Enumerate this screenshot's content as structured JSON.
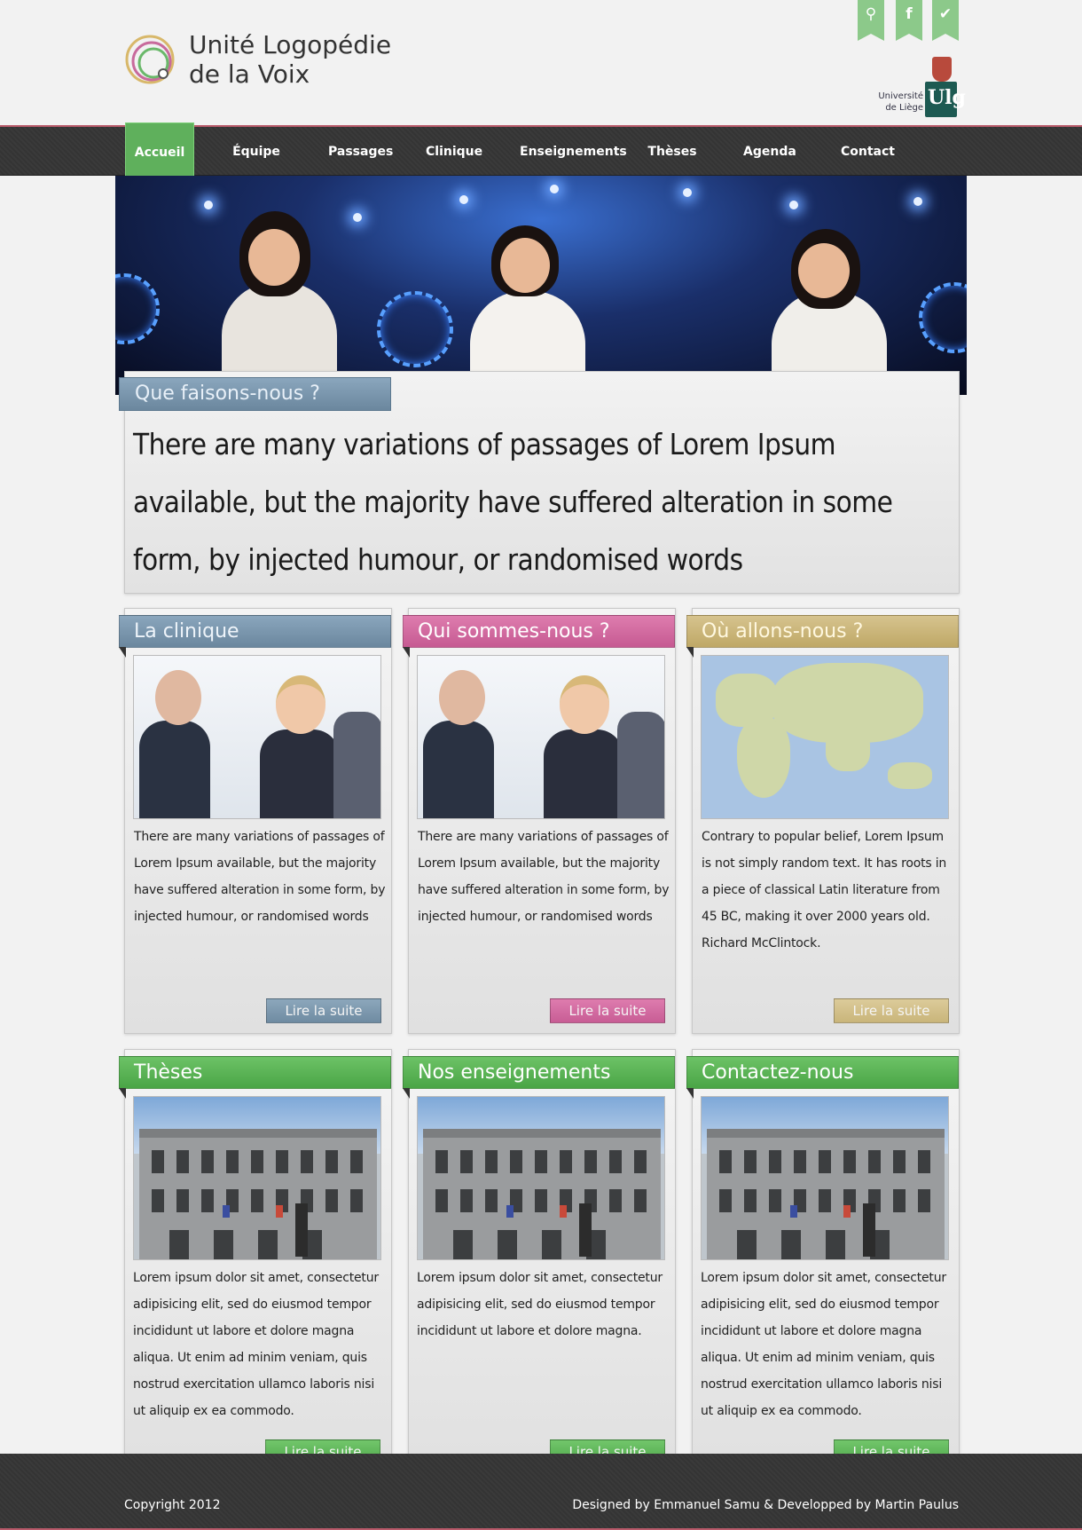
{
  "header": {
    "logo_line1": "Unité Logopédie",
    "logo_line2": "de la Voix",
    "university_line1": "Université",
    "university_line2": "de Liège",
    "university_mark": "Ulg",
    "social": [
      {
        "icon": "search-icon",
        "glyph": "⚲"
      },
      {
        "icon": "facebook-icon",
        "glyph": "f"
      },
      {
        "icon": "twitter-icon",
        "glyph": "✔"
      }
    ],
    "social_color": "#8cc98a"
  },
  "nav": {
    "items": [
      "Accueil",
      "Équipe",
      "Passages",
      "Clinique",
      "Enseignements",
      "Thèses",
      "Agenda",
      "Contact"
    ],
    "active": "Accueil",
    "active_color": "#5fb05c"
  },
  "intro": {
    "title": "Que faisons-nous ?",
    "text": "There are many variations of passages of Lorem Ipsum available, but the majority have suffered alteration in some form, by injected humour, or randomised words"
  },
  "cards": [
    {
      "title": "La clinique",
      "image": "business-people",
      "text": "There are many variations of passages of Lorem Ipsum available, but the majority have suffered alteration in some form, by injected humour, or randomised words",
      "button": "Lire la suite",
      "color": "#7a96ad"
    },
    {
      "title": "Qui sommes-nous ?",
      "image": "business-people",
      "text": "There are many variations of passages of Lorem Ipsum available, but the majority have suffered alteration in some form, by injected humour, or randomised words",
      "button": "Lire la suite",
      "color": "#d26aa0"
    },
    {
      "title": "Où allons-nous ?",
      "image": "world-map",
      "text": "Contrary to popular belief, Lorem Ipsum is not simply random text. It has roots in a piece of classical Latin literature from 45 BC, making it over 2000 years old. Richard McClintock.",
      "button": "Lire la suite",
      "color": "#cab67c"
    },
    {
      "title": "Thèses",
      "image": "university-building",
      "text": "Lorem ipsum dolor sit amet, consectetur adipisicing elit, sed do eiusmod tempor incididunt ut labore et dolore magna aliqua. Ut enim ad minim veniam, quis nostrud exercitation ullamco laboris nisi ut aliquip ex ea commodo.",
      "button": "Lire la suite",
      "color": "#5cb358"
    },
    {
      "title": "Nos enseignements",
      "image": "university-building",
      "text": "Lorem ipsum dolor sit amet, consectetur adipisicing elit, sed do eiusmod tempor incididunt ut labore et dolore magna.",
      "button": "Lire la suite",
      "color": "#5cb358"
    },
    {
      "title": "Contactez-nous",
      "image": "university-building",
      "text": "Lorem ipsum dolor sit amet, consectetur adipisicing elit, sed do eiusmod tempor incididunt ut labore et dolore magna aliqua. Ut enim ad minim veniam, quis nostrud exercitation ullamco laboris nisi ut aliquip ex ea commodo.",
      "button": "Lire la suite",
      "color": "#5cb358"
    }
  ],
  "footer": {
    "copyright": "Copyright 2012",
    "credits": "Designed by Emmanuel Samu & Developped by Martin Paulus"
  }
}
